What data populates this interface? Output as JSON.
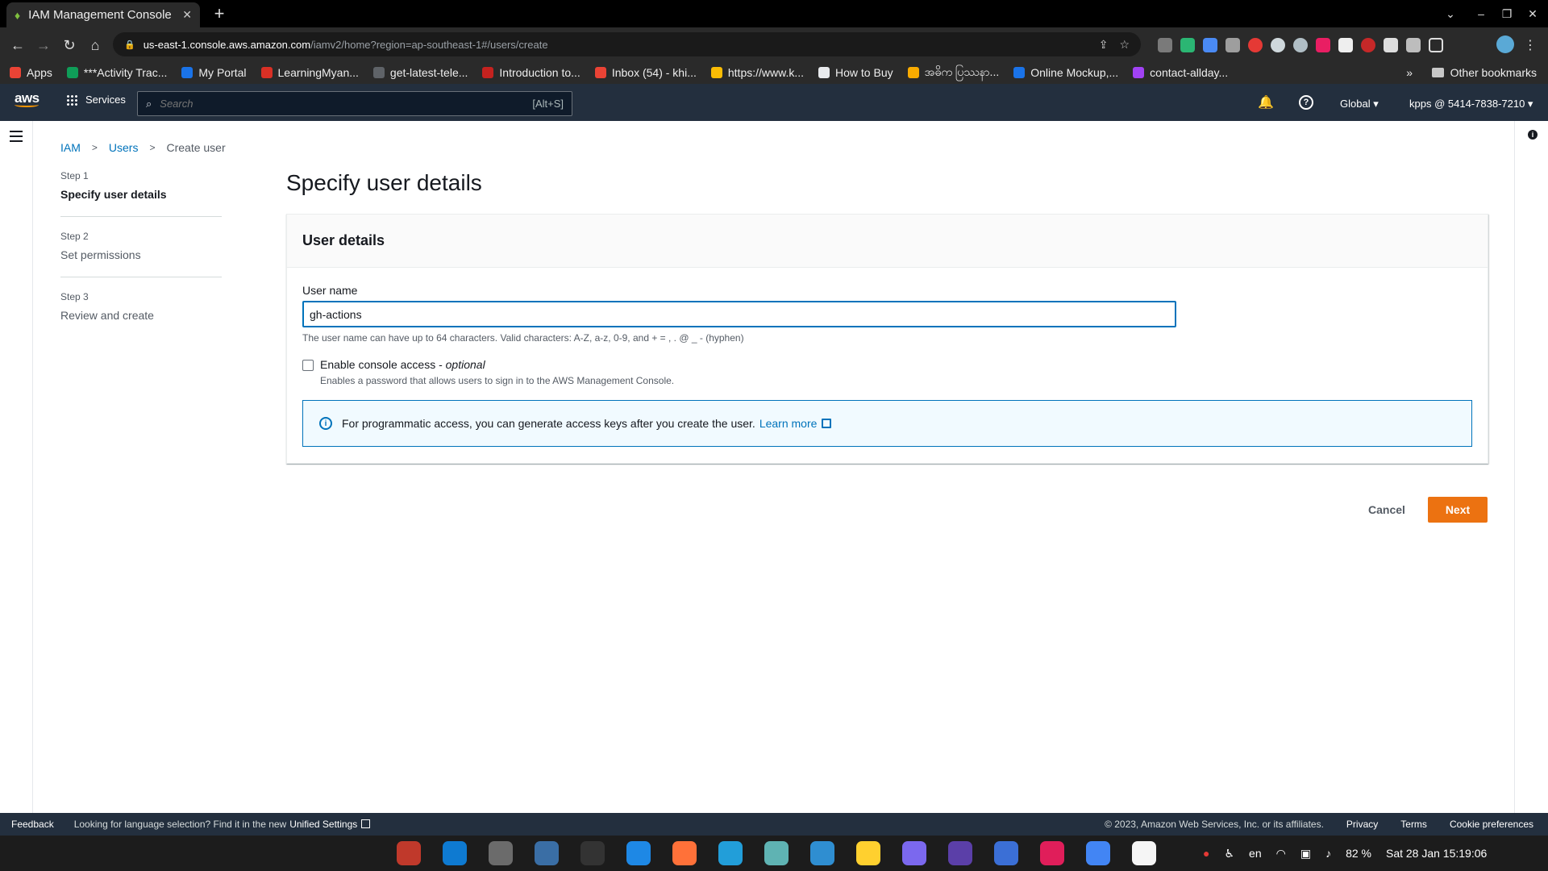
{
  "browser": {
    "tab_title": "IAM Management Console",
    "tab_close": "✕",
    "new_tab": "+",
    "url_host": "us-east-1.console.aws.amazon.com",
    "url_path": "/iamv2/home?region=ap-southeast-1#/users/create",
    "bookmarks": [
      {
        "label": "Apps",
        "color": "#ea4335"
      },
      {
        "label": "***Activity Trac...",
        "color": "#0f9d58"
      },
      {
        "label": "My Portal",
        "color": "#1a73e8"
      },
      {
        "label": "LearningMyan...",
        "color": "#d93025"
      },
      {
        "label": "get-latest-tele...",
        "color": "#5f6368"
      },
      {
        "label": "Introduction to...",
        "color": "#c5221f"
      },
      {
        "label": "Inbox (54) - khi...",
        "color": "#ea4335"
      },
      {
        "label": "https://www.k...",
        "color": "#fbbc04"
      },
      {
        "label": "How to Buy",
        "color": "#e8eaed"
      },
      {
        "label": "အဓိက ပြဿနာ...",
        "color": "#f9ab00"
      },
      {
        "label": "Online Mockup,...",
        "color": "#1a73e8"
      },
      {
        "label": "contact-allday...",
        "color": "#a142f4"
      }
    ],
    "more": "»",
    "other_bookmarks": "Other bookmarks"
  },
  "awsnav": {
    "logo": "aws",
    "services": "Services",
    "search_placeholder": "Search",
    "search_shortcut": "[Alt+S]",
    "region": "Global ▾",
    "account": "kpps @ 5414-7838-7210 ▾"
  },
  "breadcrumb": {
    "item1": "IAM",
    "item2": "Users",
    "current": "Create user",
    "sep": ">"
  },
  "steps": [
    {
      "label": "Step 1",
      "title": "Specify user details"
    },
    {
      "label": "Step 2",
      "title": "Set permissions"
    },
    {
      "label": "Step 3",
      "title": "Review and create"
    }
  ],
  "main": {
    "page_title": "Specify user details",
    "panel_title": "User details",
    "username_label": "User name",
    "username_value": "gh-actions",
    "username_hint": "The user name can have up to 64 characters. Valid characters: A-Z, a-z, 0-9, and + = , . @ _ - (hyphen)",
    "console_access_label": "Enable console access - ",
    "console_access_optional": "optional",
    "console_access_desc": "Enables a password that allows users to sign in to the AWS Management Console.",
    "alert_text": "For programmatic access, you can generate access keys after you create the user.",
    "alert_link": "Learn more",
    "cancel": "Cancel",
    "next": "Next"
  },
  "footer": {
    "feedback": "Feedback",
    "message": "Looking for language selection? Find it in the new",
    "settings_link": "Unified Settings",
    "copyright": "© 2023, Amazon Web Services, Inc. or its affiliates.",
    "privacy": "Privacy",
    "terms": "Terms",
    "cookies": "Cookie preferences"
  },
  "taskbar": {
    "lang": "en",
    "battery": "82 %",
    "datetime": "Sat 28 Jan  15:19:06",
    "dock_colors": [
      "#c0392b",
      "#0e7ad1",
      "#6b6b6b",
      "#3a6ea5",
      "#333333",
      "#1e88e5",
      "#ff7139",
      "#229ed9",
      "#5fb3b3",
      "#2f8ed1",
      "#ffd02f",
      "#7b68ee",
      "#5b3fa8",
      "#3b6fd6",
      "#e01e5a",
      "#4285f4",
      "#f5f5f5"
    ]
  }
}
